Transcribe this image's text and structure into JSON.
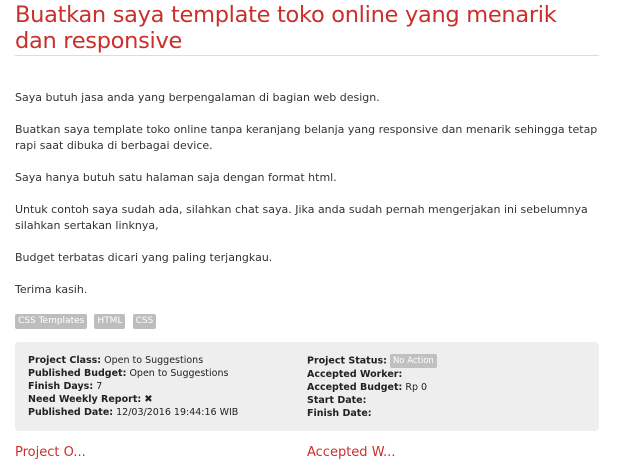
{
  "project": {
    "title": "Buatkan saya template toko online yang menarik dan responsive",
    "description": [
      "Saya butuh jasa anda yang berpengalaman di bagian web design.",
      "Buatkan saya template toko online tanpa keranjang belanja yang responsive dan menarik sehingga tetap rapi saat dibuka di berbagai device.",
      "Saya hanya butuh satu halaman saja dengan format html.",
      "Untuk contoh saya sudah ada, silahkan chat saya. Jika anda sudah pernah mengerjakan ini sebelumnya silahkan sertakan linknya,",
      "Budget terbatas dicari yang paling terjangkau.",
      "Terima kasih."
    ],
    "tags": [
      "CSS Templates",
      "HTML",
      "CSS"
    ]
  },
  "details": {
    "left": {
      "project_class_label": "Project Class:",
      "project_class_value": "Open to Suggestions",
      "published_budget_label": "Published Budget:",
      "published_budget_value": "Open to Suggestions",
      "finish_days_label": "Finish Days:",
      "finish_days_value": "7",
      "weekly_report_label": "Need Weekly Report:",
      "weekly_report_icon": "✖",
      "published_date_label": "Published Date:",
      "published_date_value": "12/03/2016 19:44:16 WIB"
    },
    "right": {
      "project_status_label": "Project Status:",
      "project_status_value": "No Action",
      "accepted_worker_label": "Accepted Worker:",
      "accepted_budget_label": "Accepted Budget:",
      "accepted_budget_value": "Rp 0",
      "start_date_label": "Start Date:",
      "finish_date_label": "Finish Date:"
    }
  },
  "sections": {
    "left_heading": "Project O...",
    "right_heading": "Accepted W..."
  },
  "colors": {
    "accent": "#c9302c",
    "panel_bg": "#eeeeee",
    "tag_bg": "#bdbdbd"
  }
}
